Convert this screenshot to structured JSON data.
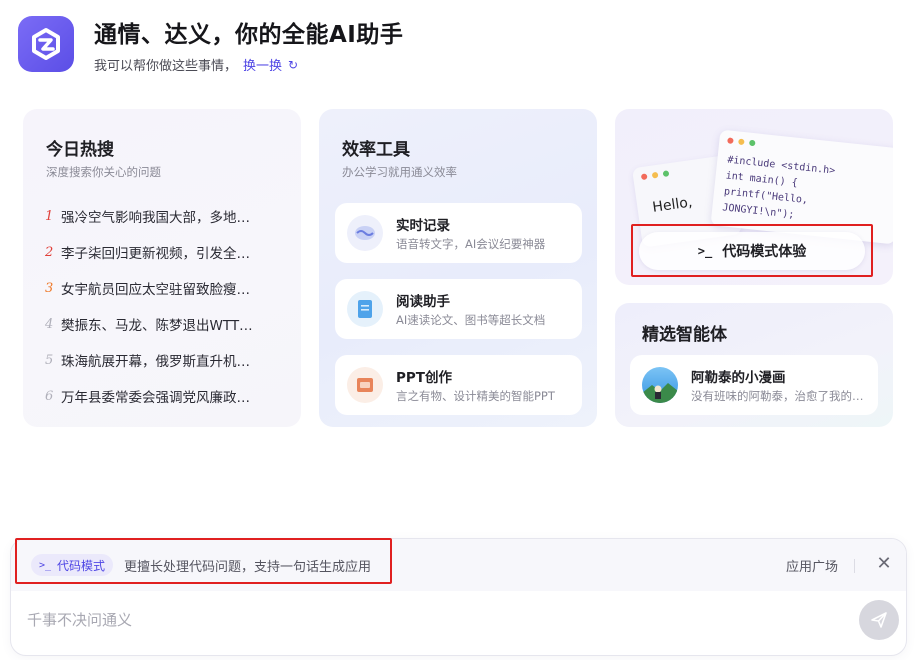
{
  "header": {
    "title": "通情、达义，你的全能AI助手",
    "subtitle": "我可以帮你做这些事情，",
    "refresh_label": "换一换",
    "refresh_icon": "refresh-icon"
  },
  "hot_search": {
    "title": "今日热搜",
    "subtitle": "深度搜索你关心的问题",
    "items": [
      {
        "rank": "1",
        "text": "强冷空气影响我国大部，多地…",
        "color": "#e0403a"
      },
      {
        "rank": "2",
        "text": "李子柒回归更新视频，引发全…",
        "color": "#e0403a"
      },
      {
        "rank": "3",
        "text": "女宇航员回应太空驻留致脸瘦…",
        "color": "#ee7a2a"
      },
      {
        "rank": "4",
        "text": "樊振东、马龙、陈梦退出WTT…",
        "color": "#b0b0ba"
      },
      {
        "rank": "5",
        "text": "珠海航展开幕，俄罗斯直升机…",
        "color": "#b0b0ba"
      },
      {
        "rank": "6",
        "text": "万年县委常委会强调党风廉政…",
        "color": "#b0b0ba"
      }
    ]
  },
  "tools": {
    "title": "效率工具",
    "subtitle": "办公学习就用通义效率",
    "items": [
      {
        "name": "实时记录",
        "desc": "语音转文字，AI会议纪要神器",
        "icon": "recording-icon"
      },
      {
        "name": "阅读助手",
        "desc": "AI速读论文、图书等超长文档",
        "icon": "document-icon"
      },
      {
        "name": "PPT创作",
        "desc": "言之有物、设计精美的智能PPT",
        "icon": "ppt-icon"
      }
    ]
  },
  "code_card": {
    "hello_text": "Hello, ",
    "code_lines": [
      "#include <stdin.h>",
      "int main() {",
      "    printf(\"Hello,",
      "JONGYI!\\n\");"
    ],
    "button_label": "代码模式体验",
    "button_icon": "terminal-icon"
  },
  "agents": {
    "title": "精选智能体",
    "item": {
      "name": "阿勒泰的小漫画",
      "desc": "没有班味的阿勒泰，治愈了我的…",
      "icon": "agent-avatar"
    }
  },
  "input": {
    "mode_chip_label": "代码模式",
    "mode_chip_icon": "terminal-icon",
    "mode_description": "更擅长处理代码问题，支持一句话生成应用",
    "app_square_label": "应用广场",
    "placeholder": "千事不决问通义",
    "send_icon": "send-icon",
    "close_icon": "close-icon"
  },
  "colors": {
    "accent": "#4f46e5",
    "highlight_box": "#e02020",
    "logo_gradient_start": "#7b6cf6",
    "logo_gradient_end": "#5b4ee6"
  }
}
